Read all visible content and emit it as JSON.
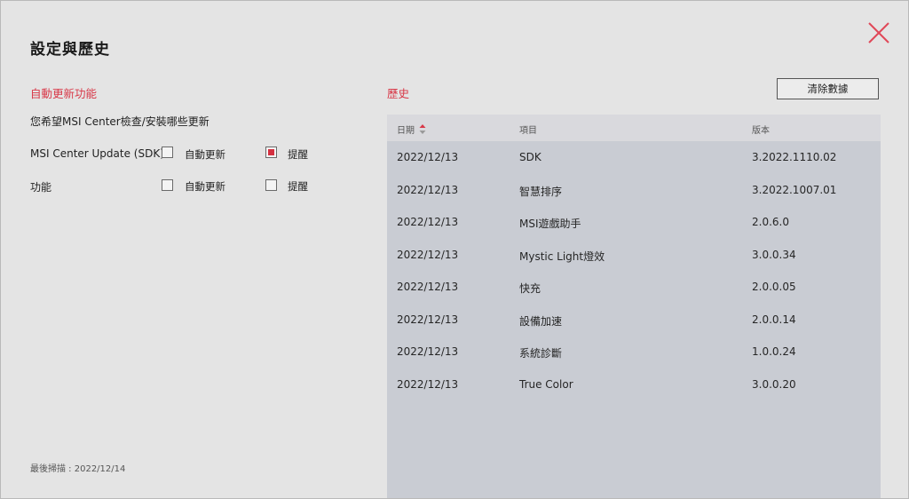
{
  "title": "設定與歷史",
  "auto_update": {
    "section_label": "自動更新功能",
    "description": "您希望MSI Center檢查/安裝哪些更新",
    "rows": [
      {
        "label": "MSI Center Update (SDK)",
        "auto_label": "自動更新",
        "auto_checked": false,
        "remind_label": "提醒",
        "remind_checked": true
      },
      {
        "label": "功能",
        "auto_label": "自動更新",
        "auto_checked": false,
        "remind_label": "提醒",
        "remind_checked": false
      }
    ],
    "last_scan": "最後掃描 : 2022/12/14"
  },
  "history": {
    "section_label": "歷史",
    "clear_button": "清除數據",
    "columns": {
      "date": "日期",
      "item": "項目",
      "version": "版本"
    },
    "rows": [
      {
        "date": "2022/12/13",
        "item": "SDK",
        "version": "3.2022.1110.02"
      },
      {
        "date": "2022/12/13",
        "item": "智慧排序",
        "version": "3.2022.1007.01"
      },
      {
        "date": "2022/12/13",
        "item": "MSI遊戲助手",
        "version": "2.0.6.0"
      },
      {
        "date": "2022/12/13",
        "item": "Mystic Light燈效",
        "version": "3.0.0.34"
      },
      {
        "date": "2022/12/13",
        "item": "快充",
        "version": "2.0.0.05"
      },
      {
        "date": "2022/12/13",
        "item": "設備加速",
        "version": "2.0.0.14"
      },
      {
        "date": "2022/12/13",
        "item": "系統診斷",
        "version": "1.0.0.24"
      },
      {
        "date": "2022/12/13",
        "item": "True Color",
        "version": "3.0.0.20"
      }
    ]
  },
  "colors": {
    "accent_red": "#d83848",
    "table_bg": "#c9ccd3",
    "dialog_bg": "#e4e4e4"
  },
  "icons": {
    "close": "close-icon",
    "sort": "sort-arrows-icon"
  }
}
